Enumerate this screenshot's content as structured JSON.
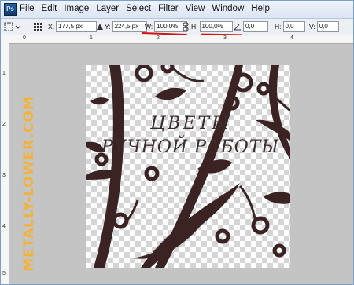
{
  "app": {
    "logo_text": "Ps"
  },
  "menu": [
    "File",
    "Edit",
    "Image",
    "Layer",
    "Select",
    "Filter",
    "View",
    "Window",
    "Help"
  ],
  "options": {
    "x_label": "X:",
    "x_value": "177,5 px",
    "y_label": "Y:",
    "y_value": "224,5 px",
    "w_label": "W:",
    "w_value": "100,0%",
    "h_label": "H:",
    "h_value": "100,0%",
    "angle_value": "0,0",
    "hskew_label": "H:",
    "hskew_value": "0,0",
    "vskew_label": "V:",
    "vskew_value": "0,0"
  },
  "ruler": {
    "top": [
      "0",
      "1",
      "2",
      "3",
      "4"
    ],
    "left": [
      "1",
      "2",
      "3",
      "4",
      "5"
    ]
  },
  "canvas": {
    "caption_line1": "ЦВЕТЫ",
    "caption_line2": "РУЧНОЙ РАБОТЫ",
    "artwork_color": "#3c2323",
    "checker_color": "#d5d5d5"
  },
  "watermark": {
    "text": "METALLY-LOWER.COM",
    "color": "#f3b33a"
  },
  "accent": {
    "underline_color": "#d01515",
    "frame_color": "#7d9ec8"
  }
}
